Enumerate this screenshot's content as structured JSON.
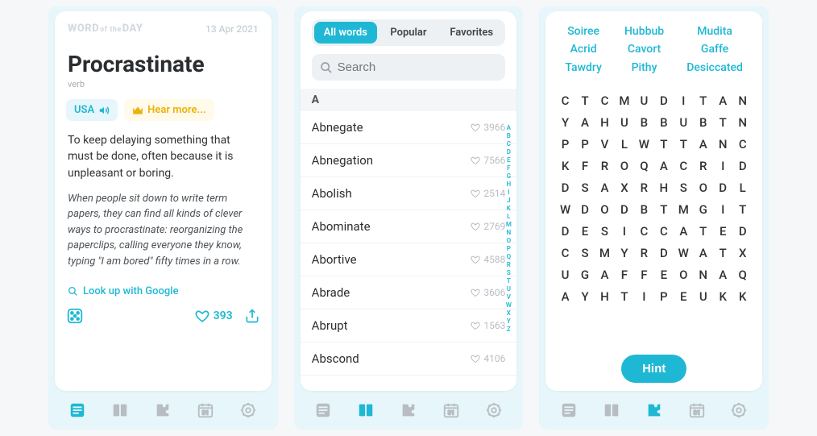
{
  "wod": {
    "logo_a": "WORD",
    "logo_mid": "of the",
    "logo_b": "DAY",
    "date": "13 Apr 2021",
    "word": "Procrastinate",
    "pos": "verb",
    "usa_label": "USA",
    "hear_label": "Hear more...",
    "definition": "To keep delaying something that must be done, often because it is unpleasant or boring.",
    "example": "When people sit down to write term papers, they can find all kinds of clever ways to procrastinate: reorganizing the paperclips, calling everyone they know, typing \"I am bored\" fifty times in a row.",
    "google": "Look up with Google",
    "likes": "393"
  },
  "dict": {
    "tabs": [
      "All words",
      "Popular",
      "Favorites"
    ],
    "search_placeholder": "Search",
    "section": "A",
    "words": [
      {
        "w": "Abnegate",
        "n": "3966"
      },
      {
        "w": "Abnegation",
        "n": "7566"
      },
      {
        "w": "Abolish",
        "n": "2514"
      },
      {
        "w": "Abominate",
        "n": "2769"
      },
      {
        "w": "Abortive",
        "n": "4588"
      },
      {
        "w": "Abrade",
        "n": "3606"
      },
      {
        "w": "Abrupt",
        "n": "1563"
      },
      {
        "w": "Abscond",
        "n": "4106"
      }
    ],
    "alpha": [
      "A",
      "B",
      "C",
      "D",
      "E",
      "F",
      "G",
      "H",
      "I",
      "J",
      "K",
      "L",
      "M",
      "N",
      "O",
      "P",
      "Q",
      "R",
      "S",
      "T",
      "U",
      "V",
      "W",
      "X",
      "Y",
      "Z"
    ]
  },
  "game": {
    "targets": [
      [
        "Soiree",
        "Acrid",
        "Tawdry"
      ],
      [
        "Hubbub",
        "Cavort",
        "Pithy"
      ],
      [
        "Mudita",
        "Gaffe",
        "Desiccated"
      ]
    ],
    "grid": [
      [
        "C",
        "T",
        "C",
        "M",
        "U",
        "D",
        "I",
        "T",
        "A",
        "N"
      ],
      [
        "Y",
        "A",
        "H",
        "U",
        "B",
        "B",
        "U",
        "B",
        "T",
        "N"
      ],
      [
        "P",
        "P",
        "V",
        "L",
        "W",
        "T",
        "T",
        "A",
        "N",
        "C"
      ],
      [
        "K",
        "F",
        "R",
        "O",
        "Q",
        "A",
        "C",
        "R",
        "I",
        "D"
      ],
      [
        "D",
        "S",
        "A",
        "X",
        "R",
        "H",
        "S",
        "O",
        "D",
        "L"
      ],
      [
        "W",
        "D",
        "O",
        "D",
        "B",
        "T",
        "M",
        "G",
        "I",
        "T"
      ],
      [
        "D",
        "E",
        "S",
        "I",
        "C",
        "C",
        "A",
        "T",
        "E",
        "D"
      ],
      [
        "C",
        "S",
        "M",
        "Y",
        "R",
        "D",
        "W",
        "A",
        "T",
        "X"
      ],
      [
        "U",
        "G",
        "A",
        "F",
        "F",
        "E",
        "O",
        "N",
        "A",
        "Q"
      ],
      [
        "A",
        "Y",
        "H",
        "T",
        "I",
        "P",
        "E",
        "U",
        "K",
        "K"
      ]
    ],
    "hint": "Hint"
  }
}
